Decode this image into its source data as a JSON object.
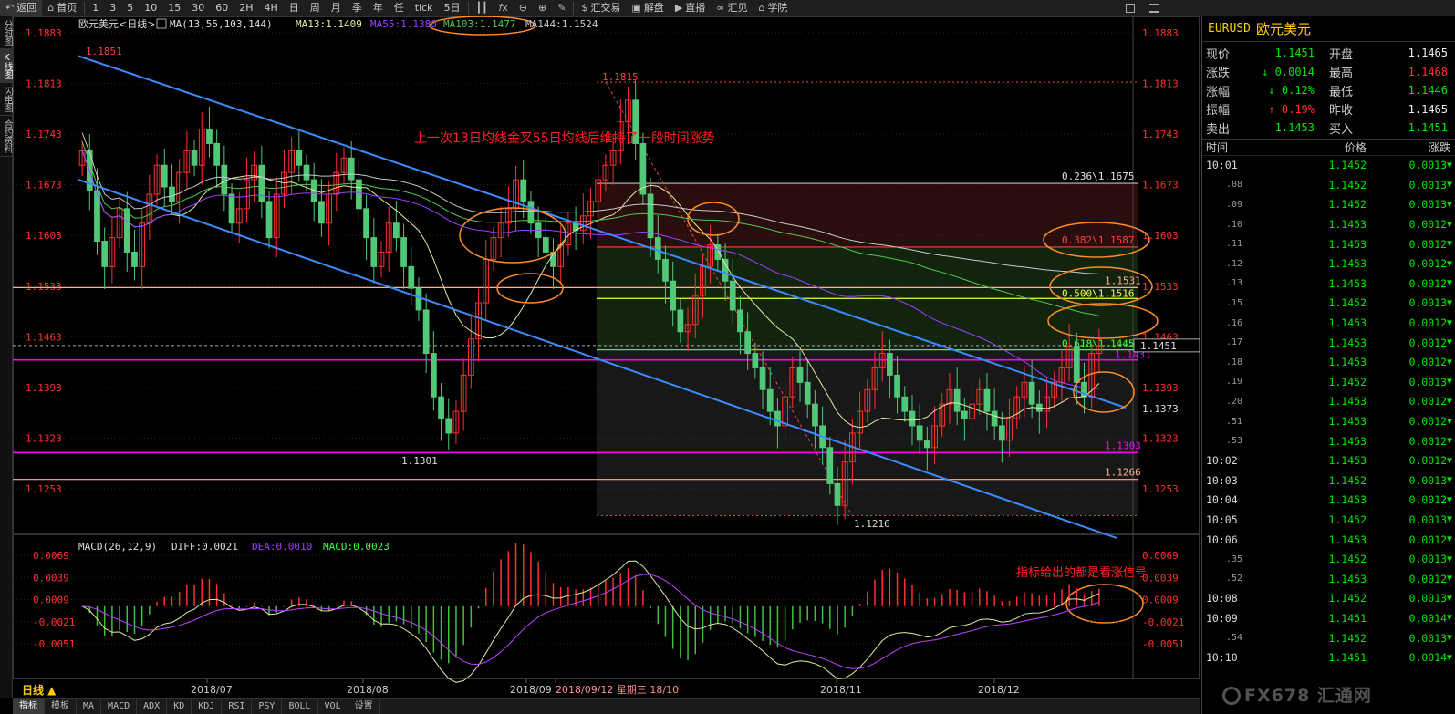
{
  "toolbar": {
    "items": [
      {
        "icon": "back-icon",
        "glyph": "↶",
        "label": "返回"
      },
      {
        "icon": "home-icon",
        "glyph": "⌂",
        "label": "首页"
      },
      {
        "label": "1"
      },
      {
        "label": "3"
      },
      {
        "label": "5"
      },
      {
        "label": "10"
      },
      {
        "label": "15"
      },
      {
        "label": "30"
      },
      {
        "label": "60"
      },
      {
        "label": "2H"
      },
      {
        "label": "4H"
      },
      {
        "label": "日"
      },
      {
        "label": "周"
      },
      {
        "label": "月"
      },
      {
        "label": "季"
      },
      {
        "label": "年"
      },
      {
        "label": "任"
      },
      {
        "label": "tick"
      },
      {
        "label": "5日"
      },
      {
        "icon": "candle-icon",
        "glyph": "┃┃"
      },
      {
        "icon": "formula-icon",
        "glyph": "𝑓x"
      },
      {
        "icon": "zoom-out-icon",
        "glyph": "⊖"
      },
      {
        "icon": "zoom-in-icon",
        "glyph": "⊕"
      },
      {
        "icon": "draw-icon",
        "glyph": "✎"
      },
      {
        "icon": "dollar-icon",
        "glyph": "$",
        "label": "汇交易"
      },
      {
        "icon": "chat-icon",
        "glyph": "▣",
        "label": "解盘"
      },
      {
        "icon": "live-icon",
        "glyph": "▶",
        "label": "直播"
      },
      {
        "icon": "link-icon",
        "glyph": "∞",
        "label": "汇见"
      },
      {
        "icon": "school-icon",
        "glyph": "⌂",
        "label": "学院"
      }
    ],
    "right_icons": [
      "layout-icon",
      "menu-icon"
    ]
  },
  "left_tabs": [
    "分时图",
    "K线图",
    "闪电图",
    "合约资料"
  ],
  "chart_header": {
    "title": "欧元美元<日线>",
    "ma_label": "MA(13,55,103,144)",
    "ma13": "MA13:1.1409",
    "ma55": "MA55:1.1380",
    "ma103": "MA103:1.1477",
    "ma144": "MA144:1.1524"
  },
  "macd_header": {
    "label": "MACD(26,12,9)",
    "diff": "DIFF:0.0021",
    "dea": "DEA:0.0010",
    "macd": "MACD:0.0023"
  },
  "annotations": {
    "cross_note": "上一次13日均线金叉55日均线后维持了一段时间涨势",
    "macd_note": "指标给出的都是看涨信号"
  },
  "levels": {
    "fib236": "0.236\\1.1675",
    "fib382": "0.382\\1.1587",
    "l1531": "1.1531",
    "fib500": "0.500\\1.1516",
    "fib618": "0.618\\1.1445",
    "l1431": "1.1431",
    "l1303": "1.1303",
    "l1266": "1.1266",
    "high_1851": "1.1851",
    "high_1815": "1.1815",
    "low_1301": "1.1301",
    "low_1216": "1.1216",
    "cur_price": "1.1451",
    "right_1373": "1.1373"
  },
  "price_axis": [
    "1.1883",
    "1.1813",
    "1.1743",
    "1.1673",
    "1.1603",
    "1.1533",
    "1.1463",
    "1.1393",
    "1.1323",
    "1.1253"
  ],
  "macd_axis": [
    "0.0069",
    "0.0039",
    "0.0009",
    "-0.0021",
    "-0.0051"
  ],
  "date_axis": [
    {
      "label": "2018/07"
    },
    {
      "label": "2018/08"
    },
    {
      "label": "2018/09"
    },
    {
      "label": "2018/09/12 星期三 18/10"
    },
    {
      "label": "2018/11"
    },
    {
      "label": "2018/12"
    }
  ],
  "period_label": "日线 ▲",
  "bottom_tabs": [
    "指标",
    "模板",
    "MA",
    "MACD",
    "ADX",
    "KD",
    "KDJ",
    "RSI",
    "PSY",
    "BOLL",
    "VOL",
    "设置"
  ],
  "quote": {
    "code": "EURUSD",
    "name": "欧元美元",
    "rows": [
      {
        "l": "现价",
        "v": "1.1451",
        "vc": "green",
        "r": "开盘",
        "v2": "1.1465",
        "v2c": "white"
      },
      {
        "l": "涨跌",
        "v": "↓ 0.0014",
        "vc": "green",
        "r": "最高",
        "v2": "1.1468",
        "v2c": "red"
      },
      {
        "l": "涨幅",
        "v": "↓ 0.12%",
        "vc": "green",
        "r": "最低",
        "v2": "1.1446",
        "v2c": "green"
      },
      {
        "l": "振幅",
        "v": "↑ 0.19%",
        "vc": "red",
        "r": "昨收",
        "v2": "1.1465",
        "v2c": "white"
      },
      {
        "l": "卖出",
        "v": "1.1453",
        "vc": "green",
        "r": "买入",
        "v2": "1.1451",
        "v2c": "green"
      }
    ]
  },
  "ticks_header": [
    "时间",
    "价格",
    "涨跌"
  ],
  "ticks": [
    {
      "t": "10:01",
      "sub": false,
      "p": "1.1452",
      "c": "0.0013"
    },
    {
      "t": ".08",
      "sub": true,
      "p": "1.1452",
      "c": "0.0013"
    },
    {
      "t": ".09",
      "sub": true,
      "p": "1.1452",
      "c": "0.0013"
    },
    {
      "t": ".10",
      "sub": true,
      "p": "1.1453",
      "c": "0.0012"
    },
    {
      "t": ".11",
      "sub": true,
      "p": "1.1453",
      "c": "0.0012"
    },
    {
      "t": ".12",
      "sub": true,
      "p": "1.1453",
      "c": "0.0012"
    },
    {
      "t": ".13",
      "sub": true,
      "p": "1.1453",
      "c": "0.0012"
    },
    {
      "t": ".15",
      "sub": true,
      "p": "1.1452",
      "c": "0.0013"
    },
    {
      "t": ".16",
      "sub": true,
      "p": "1.1453",
      "c": "0.0012"
    },
    {
      "t": ".17",
      "sub": true,
      "p": "1.1453",
      "c": "0.0012"
    },
    {
      "t": ".18",
      "sub": true,
      "p": "1.1453",
      "c": "0.0012"
    },
    {
      "t": ".19",
      "sub": true,
      "p": "1.1452",
      "c": "0.0013"
    },
    {
      "t": ".20",
      "sub": true,
      "p": "1.1453",
      "c": "0.0012"
    },
    {
      "t": ".51",
      "sub": true,
      "p": "1.1453",
      "c": "0.0012"
    },
    {
      "t": ".53",
      "sub": true,
      "p": "1.1453",
      "c": "0.0012"
    },
    {
      "t": "10:02",
      "sub": false,
      "p": "1.1453",
      "c": "0.0012"
    },
    {
      "t": "10:03",
      "sub": false,
      "p": "1.1452",
      "c": "0.0013"
    },
    {
      "t": "10:04",
      "sub": false,
      "p": "1.1453",
      "c": "0.0012"
    },
    {
      "t": "10:05",
      "sub": false,
      "p": "1.1452",
      "c": "0.0013"
    },
    {
      "t": "10:06",
      "sub": false,
      "p": "1.1453",
      "c": "0.0012"
    },
    {
      "t": ".35",
      "sub": true,
      "p": "1.1452",
      "c": "0.0013"
    },
    {
      "t": ".52",
      "sub": true,
      "p": "1.1453",
      "c": "0.0012"
    },
    {
      "t": "10:08",
      "sub": false,
      "p": "1.1452",
      "c": "0.0013"
    },
    {
      "t": "10:09",
      "sub": false,
      "p": "1.1451",
      "c": "0.0014"
    },
    {
      "t": ".54",
      "sub": true,
      "p": "1.1452",
      "c": "0.0013"
    },
    {
      "t": "10:10",
      "sub": false,
      "p": "1.1451",
      "c": "0.0014"
    }
  ],
  "watermark": "FX678 汇通网",
  "colors": {
    "up": "#ff3030",
    "down": "#00e600",
    "ma13": "#e8e8a0",
    "ma55": "#a040ff",
    "ma103": "#50c850",
    "ma144": "#c8c8c8",
    "channel": "#3c8cff",
    "magenta_level": "#ff00ff",
    "annotation": "#ff2020",
    "ellipse": "#ff8c28"
  }
}
